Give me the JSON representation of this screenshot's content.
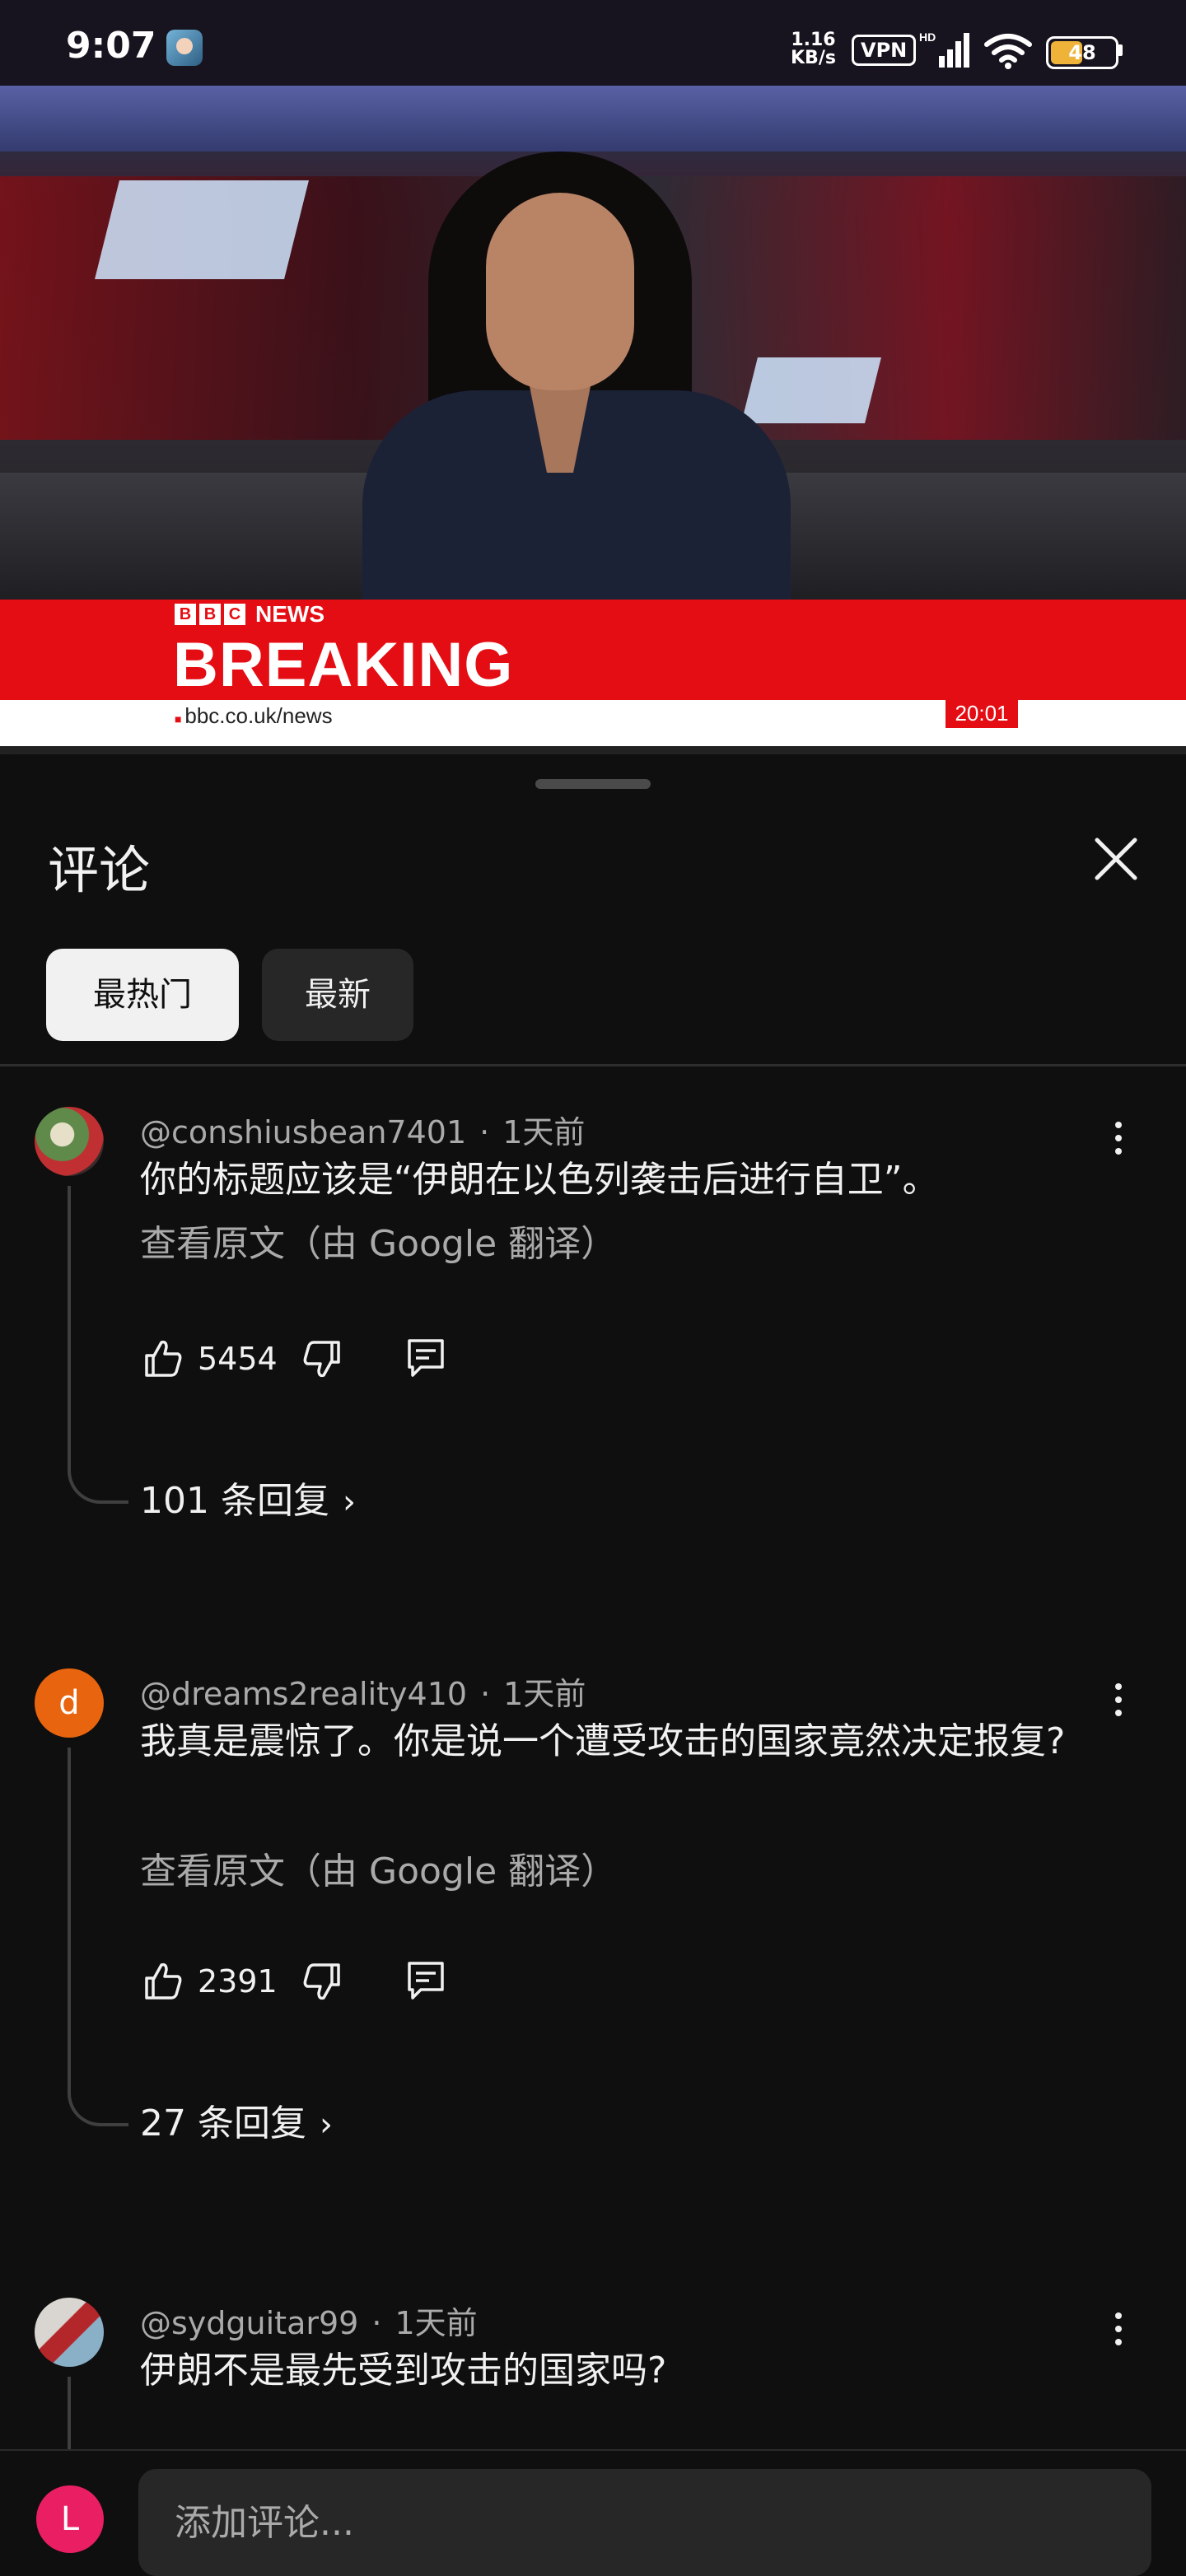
{
  "status_bar": {
    "time": "9:07",
    "net_speed_value": "1.16",
    "net_speed_unit": "KB/s",
    "vpn_label": "VPN",
    "battery_level": "48",
    "icons": [
      "app-avatar-icon",
      "hd-signal-icon",
      "wifi-icon",
      "battery-icon"
    ]
  },
  "video": {
    "network_letters": [
      "B",
      "B",
      "C"
    ],
    "network_name": "NEWS",
    "headline": "BREAKING",
    "url": "bbc.co.uk/news",
    "clock": "20:01"
  },
  "comments_panel": {
    "title": "评论",
    "close_icon": "close-icon",
    "sort_tabs": [
      {
        "label": "最热门",
        "selected": true
      },
      {
        "label": "最新",
        "selected": false
      }
    ]
  },
  "comments": [
    {
      "author": "@conshiusbean7401",
      "time": "1天前",
      "text": "你的标题应该是“伊朗在以色列袭击后进行自卫”。",
      "translate_label": "查看原文（由 Google 翻译）",
      "likes": "5454",
      "replies_label": "101 条回复"
    },
    {
      "author": "@dreams2reality410",
      "avatar_letter": "d",
      "time": "1天前",
      "text": "我真是震惊了。你是说一个遭受攻击的国家竟然决定报复?",
      "translate_label": "查看原文（由 Google 翻译）",
      "likes": "2391",
      "replies_label": "27 条回复"
    },
    {
      "author": "@sydguitar99",
      "time": "1天前",
      "text": "伊朗不是最先受到攻击的国家吗?"
    }
  ],
  "input_bar": {
    "user_initial": "L",
    "placeholder": "添加评论..."
  },
  "colors": {
    "background": "#0f0f0f",
    "chip_selected": "#f1f1f1",
    "chip_unselected": "#272727",
    "muted_text": "#aaaaaa",
    "bbc_red": "#e40d13",
    "avatar_orange": "#e8640e",
    "user_avatar_pink": "#e91e63"
  }
}
